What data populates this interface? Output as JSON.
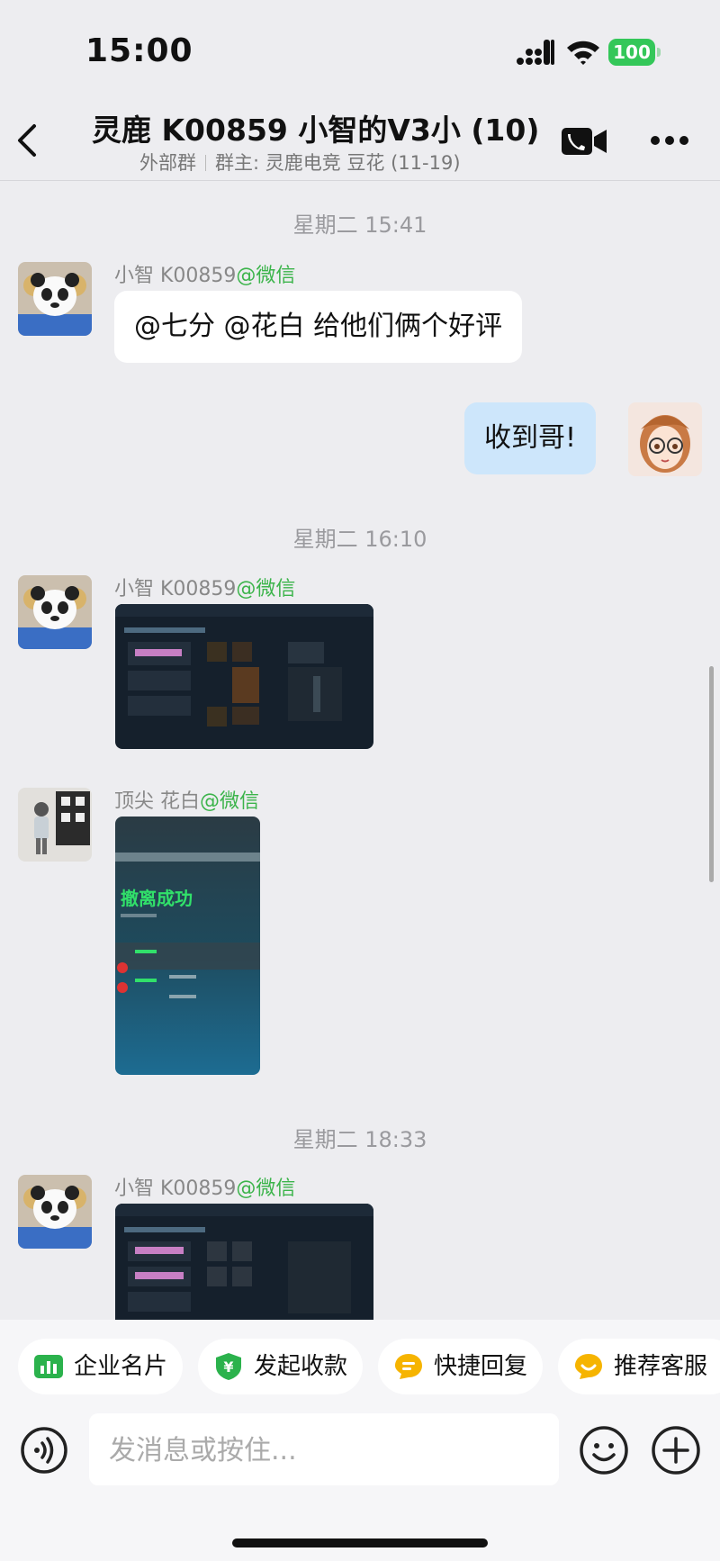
{
  "status_bar": {
    "time": "15:00",
    "battery": "100"
  },
  "header": {
    "title": "灵鹿 K00859 小智的V3小 (10)",
    "subtitle_left": "外部群",
    "subtitle_right": "群主: 灵鹿电竞 豆花 (11-19)"
  },
  "messages": [
    {
      "timestamp": "星期二 15:41"
    },
    {
      "sender": "小智 K00859",
      "source": "@微信",
      "text": "@七分 @花白 给他们俩个好评"
    },
    {
      "mine": true,
      "text": "收到哥!"
    },
    {
      "timestamp": "星期二 16:10"
    },
    {
      "sender": "小智 K00859",
      "source": "@微信"
    },
    {
      "sender": "顶尖 花白",
      "source": "@微信",
      "image_text": "撤离成功"
    },
    {
      "timestamp": "星期二 18:33"
    },
    {
      "sender": "小智 K00859",
      "source": "@微信"
    }
  ],
  "quick_actions": [
    {
      "label": "企业名片",
      "icon": "business-card-icon",
      "color": "#2bb24c"
    },
    {
      "label": "发起收款",
      "icon": "payment-shield-icon",
      "color": "#2bb24c"
    },
    {
      "label": "快捷回复",
      "icon": "quick-reply-icon",
      "color": "#f6b400"
    },
    {
      "label": "推荐客服",
      "icon": "recommend-service-icon",
      "color": "#f6b400"
    }
  ],
  "composer": {
    "placeholder": "发消息或按住..."
  },
  "colors": {
    "accent_green": "#3cb44b",
    "bubble_mine": "#cde6fb",
    "battery": "#34c759"
  }
}
